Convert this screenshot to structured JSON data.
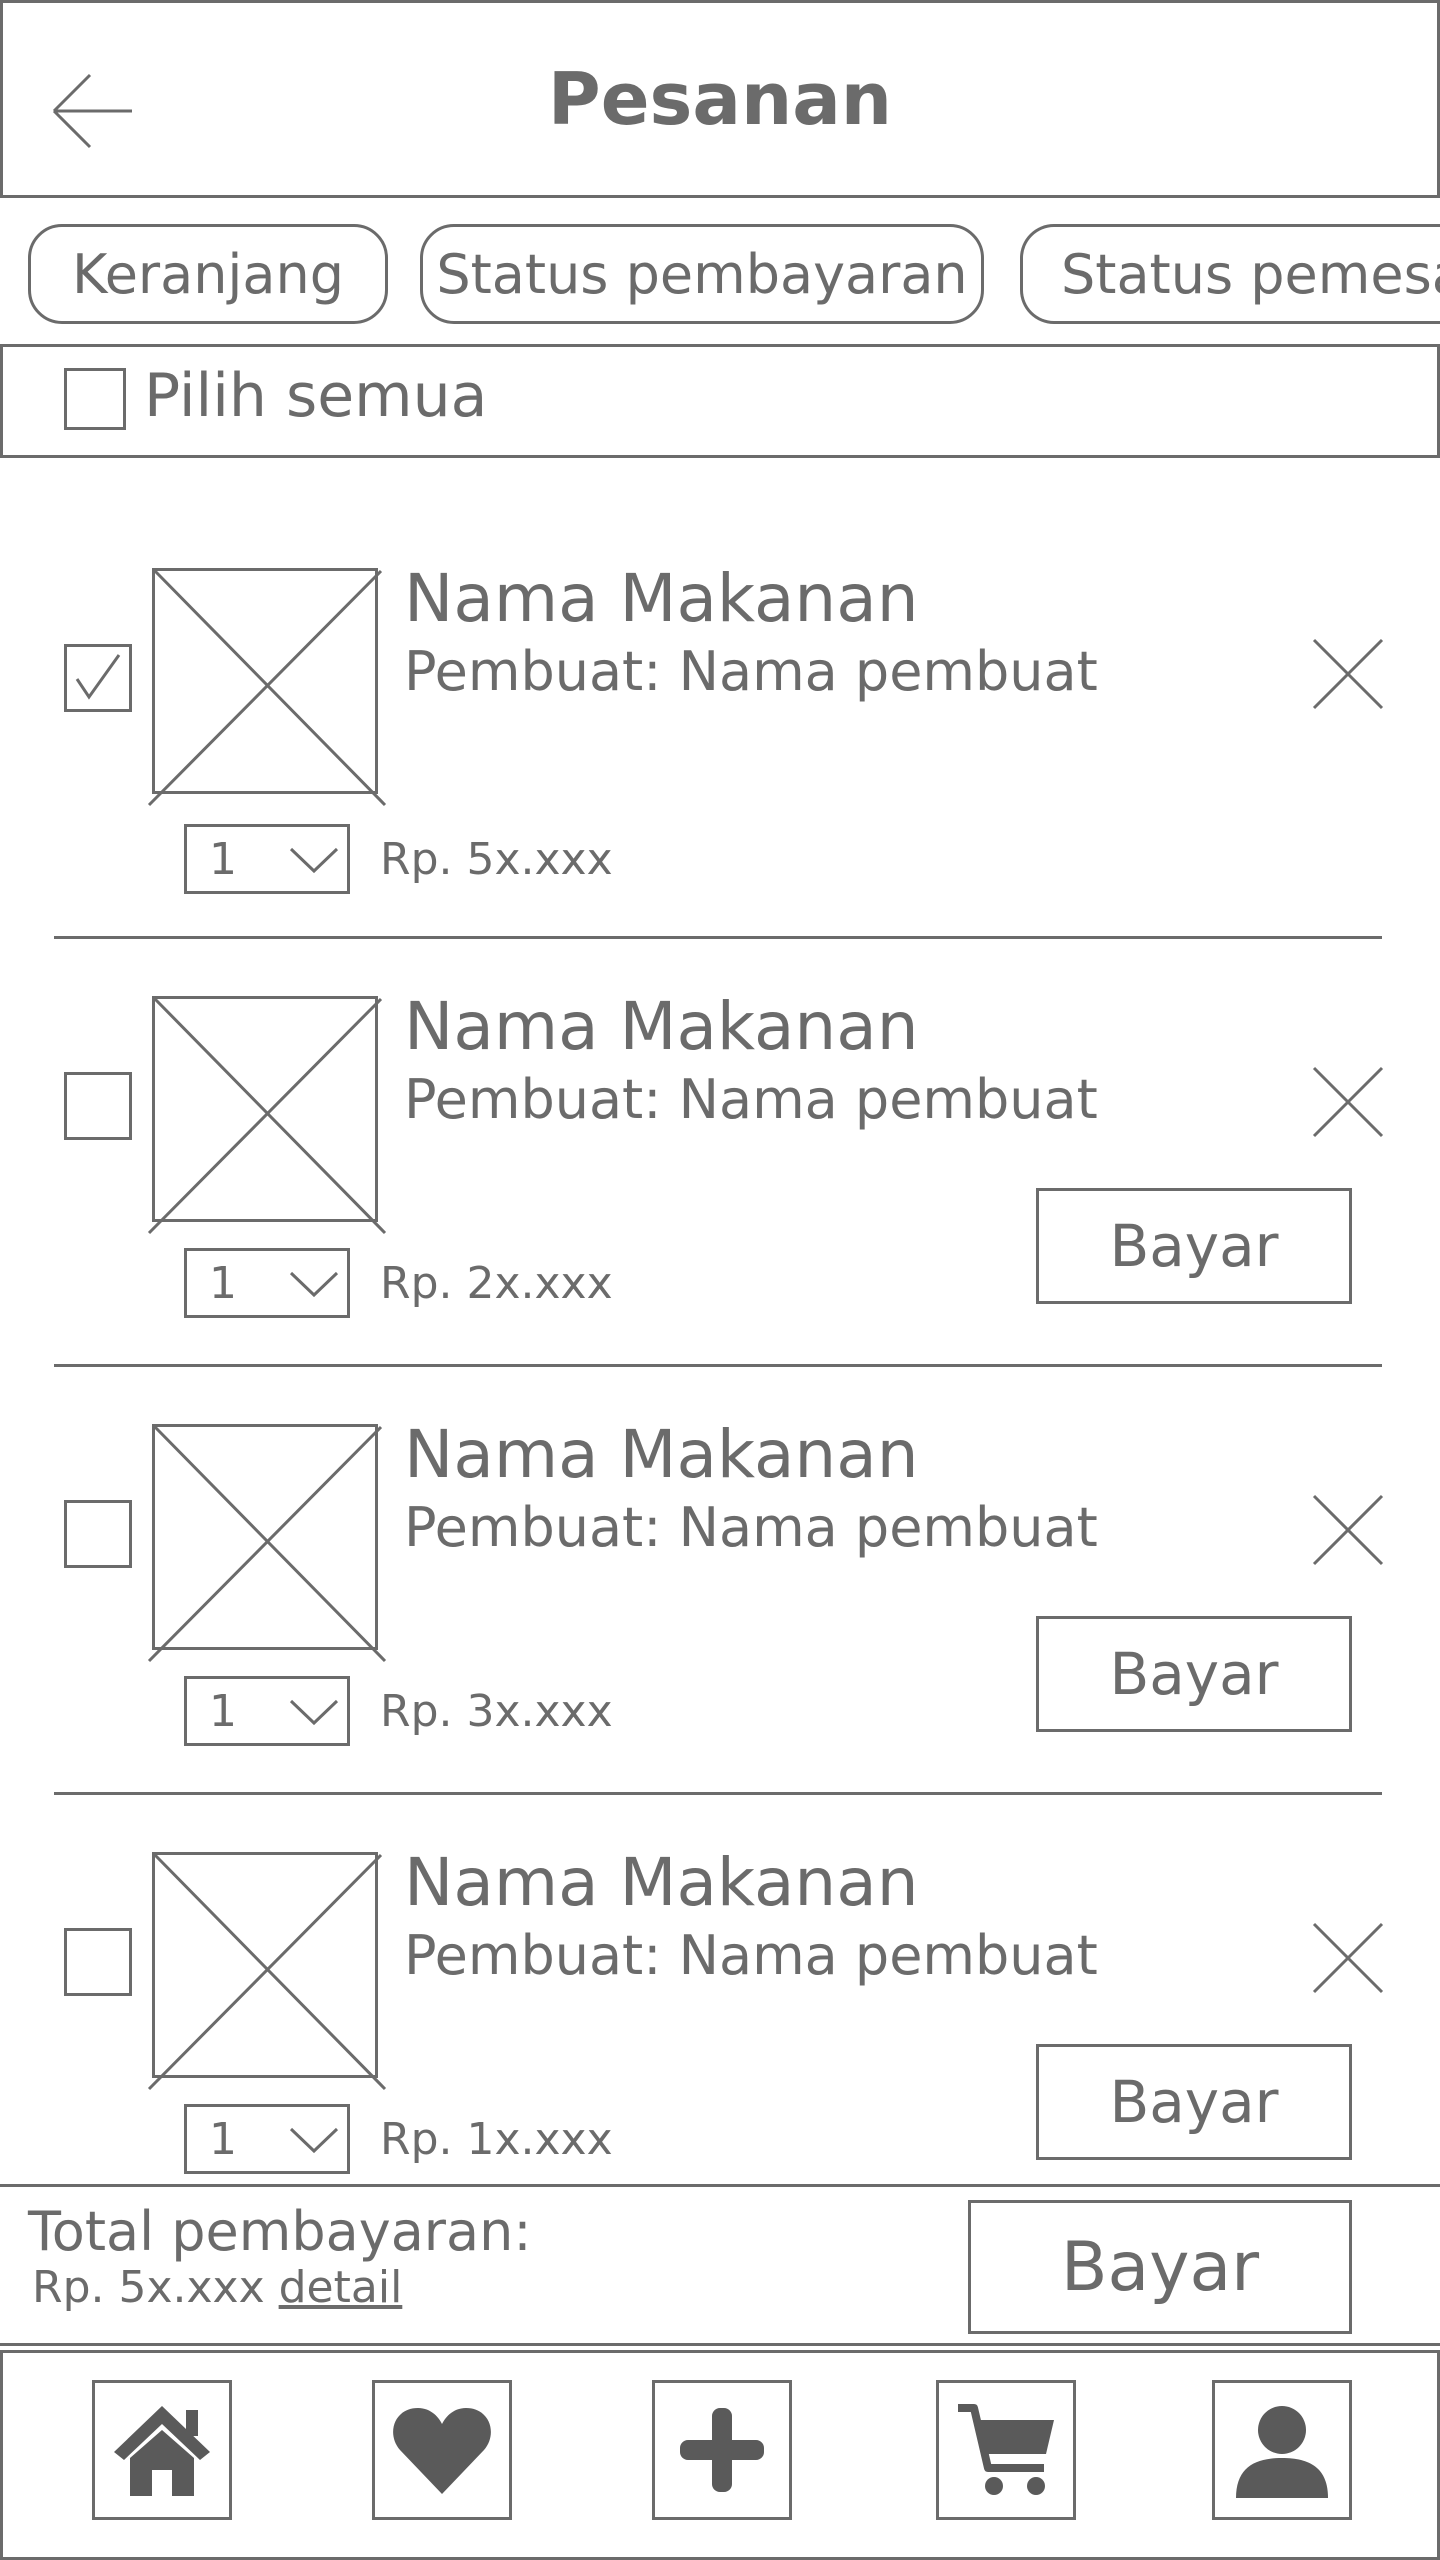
{
  "header": {
    "title": "Pesanan",
    "back_icon": "arrow-left-icon"
  },
  "tabs": [
    {
      "label": "Keranjang"
    },
    {
      "label": "Status pembayaran"
    },
    {
      "label": "Status pemesanan"
    }
  ],
  "select_all": {
    "label": "Pilih semua",
    "checked": false
  },
  "items": [
    {
      "name": "Nama Makanan",
      "maker": "Pembuat: Nama pembuat",
      "qty": "1",
      "price": "Rp. 5x.xxx",
      "checked": true,
      "pay_label": ""
    },
    {
      "name": "Nama Makanan",
      "maker": "Pembuat: Nama pembuat",
      "qty": "1",
      "price": "Rp. 2x.xxx",
      "checked": false,
      "pay_label": "Bayar"
    },
    {
      "name": "Nama Makanan",
      "maker": "Pembuat: Nama pembuat",
      "qty": "1",
      "price": "Rp. 3x.xxx",
      "checked": false,
      "pay_label": "Bayar"
    },
    {
      "name": "Nama Makanan",
      "maker": "Pembuat: Nama pembuat",
      "qty": "1",
      "price": "Rp. 1x.xxx",
      "checked": false,
      "pay_label": "Bayar"
    }
  ],
  "total": {
    "label": "Total pembayaran:",
    "amount": "Rp. 5x.xxx",
    "detail_link": "detail",
    "pay_label": "Bayar"
  },
  "bottom_nav": [
    {
      "icon": "home-icon"
    },
    {
      "icon": "heart-icon"
    },
    {
      "icon": "plus-icon"
    },
    {
      "icon": "cart-icon"
    },
    {
      "icon": "user-icon"
    }
  ],
  "colors": {
    "stroke": "#6b6b6b",
    "background": "#ffffff"
  }
}
